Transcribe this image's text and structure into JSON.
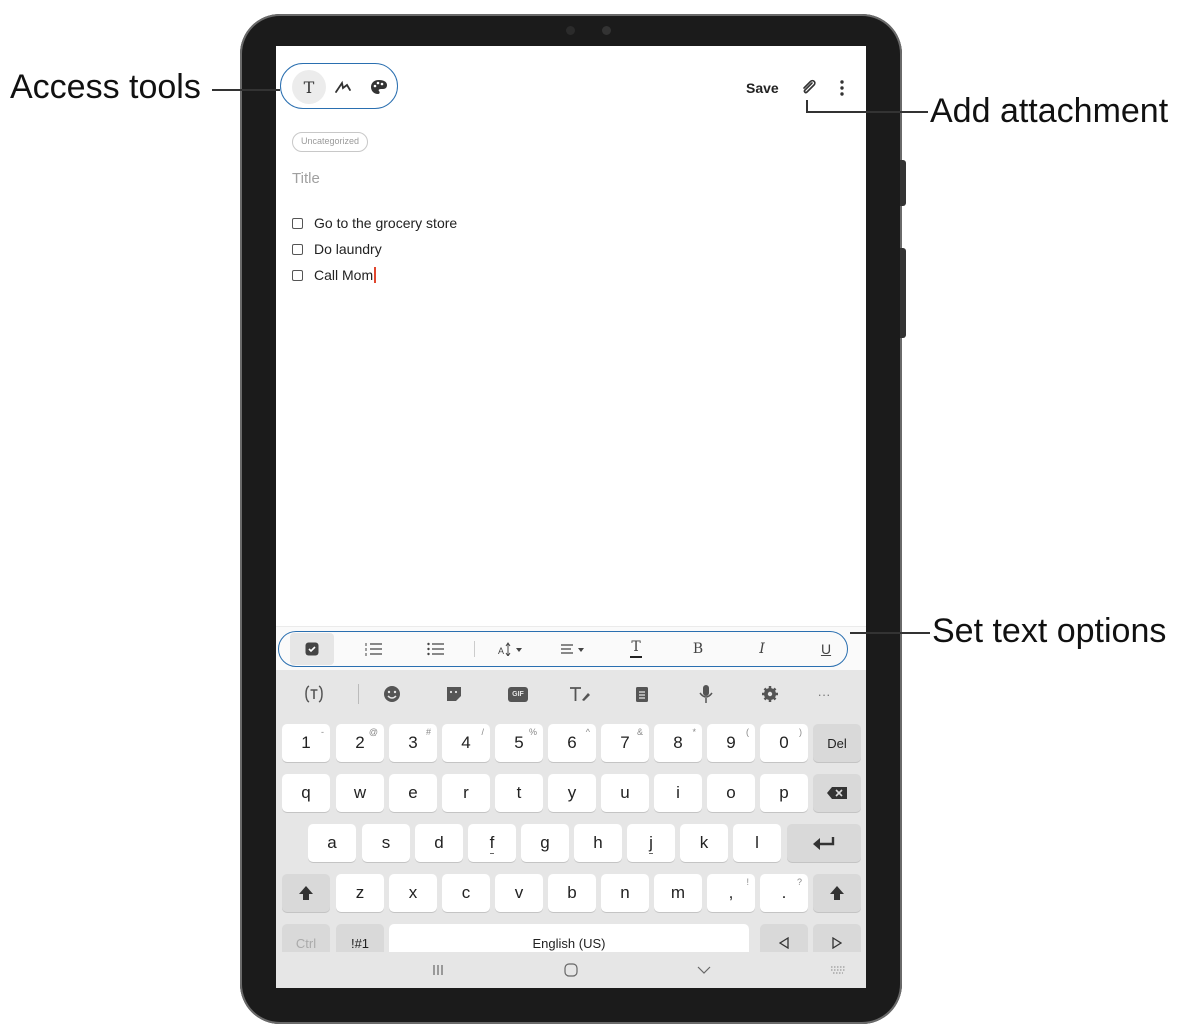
{
  "callouts": {
    "access_tools": "Access tools",
    "add_attachment": "Add attachment",
    "set_text_options": "Set text options"
  },
  "header": {
    "tools": [
      "text-icon",
      "pen-icon",
      "palette-icon"
    ],
    "text_tool_glyph": "T",
    "save_label": "Save"
  },
  "note": {
    "category": "Uncategorized",
    "title_placeholder": "Title",
    "checklist": [
      {
        "text": "Go to the grocery store",
        "checked": false
      },
      {
        "text": "Do laundry",
        "checked": false
      },
      {
        "text": "Call Mom",
        "checked": false
      }
    ]
  },
  "text_options": {
    "items": [
      "checkbox-icon",
      "numbered-list-icon",
      "bullet-list-icon",
      "font-size-icon",
      "align-icon",
      "text-color-icon",
      "bold-icon",
      "italic-icon",
      "underline-icon"
    ],
    "bold": "B",
    "italic": "I",
    "underline": "U",
    "text_color": "T"
  },
  "keyboard": {
    "toolbar": [
      "text-recognition-icon",
      "emoji-icon",
      "sticker-icon",
      "gif-icon",
      "handwriting-icon",
      "clipboard-icon",
      "mic-icon",
      "settings-icon",
      "more-icon"
    ],
    "gif": "GIF",
    "row1": [
      {
        "k": "1",
        "s": "-"
      },
      {
        "k": "2",
        "s": "@"
      },
      {
        "k": "3",
        "s": "#"
      },
      {
        "k": "4",
        "s": "/"
      },
      {
        "k": "5",
        "s": "%"
      },
      {
        "k": "6",
        "s": "^"
      },
      {
        "k": "7",
        "s": "&"
      },
      {
        "k": "8",
        "s": "*"
      },
      {
        "k": "9",
        "s": "("
      },
      {
        "k": "0",
        "s": ")"
      }
    ],
    "del": "Del",
    "row2": [
      "q",
      "w",
      "e",
      "r",
      "t",
      "y",
      "u",
      "i",
      "o",
      "p"
    ],
    "row3": [
      "a",
      "s",
      "d",
      "f",
      "g",
      "h",
      "j",
      "k",
      "l"
    ],
    "row4": [
      "z",
      "x",
      "c",
      "v",
      "b",
      "n",
      "m"
    ],
    "comma": ",",
    "comma_sup": "!",
    "period": ".",
    "period_sup": "?",
    "ctrl": "Ctrl",
    "symbols": "!#1",
    "space": "English (US)"
  },
  "navbar": [
    "recents-icon",
    "home-icon",
    "hide-keyboard-icon",
    "keyboard-icon"
  ]
}
